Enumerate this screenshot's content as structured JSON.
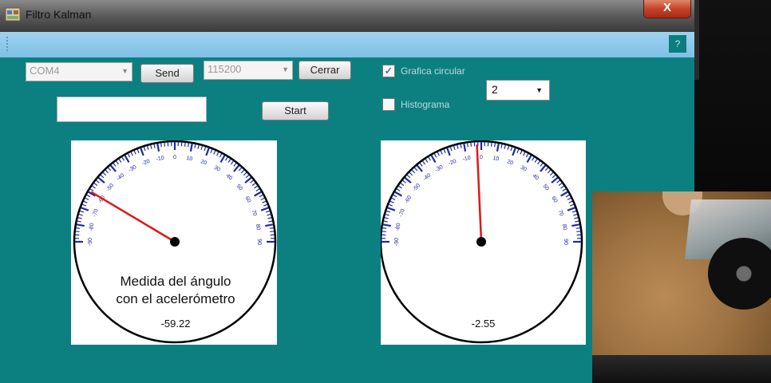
{
  "window": {
    "title": "Filtro Kalman",
    "close_glyph": "X",
    "help_label": "?"
  },
  "controls": {
    "port_combo": "COM4",
    "send_label": "Send",
    "baud_combo": "115200",
    "close_label": "Cerrar",
    "start_label": "Start",
    "text_input_value": "",
    "grafica_circular": {
      "label": "Grafica circular",
      "checked": true
    },
    "histograma": {
      "label": "Histograma",
      "checked": false
    },
    "count_select": "2"
  },
  "gauges": [
    {
      "caption_line1": "Medida del ángulo",
      "caption_line2": "con el acelerómetro",
      "value_text": "-59.22",
      "angle": -59.22
    },
    {
      "caption_line1": "",
      "caption_line2": "",
      "value_text": "-2.55",
      "angle": -2.55
    }
  ],
  "icons": {
    "app_icon": "window-app-icon",
    "check_mark": "✓",
    "dropdown": "▼"
  },
  "colors": {
    "form_bg": "#0c8080",
    "tick": "#1f2aa8",
    "needle": "#e01818"
  }
}
